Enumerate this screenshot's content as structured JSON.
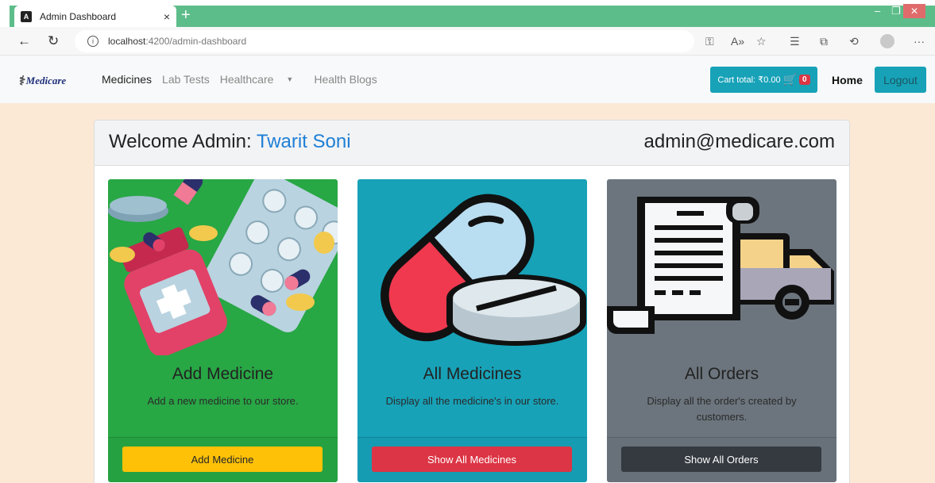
{
  "browser": {
    "tab_title": "Admin Dashboard",
    "tab_close": "×",
    "new_tab": "+",
    "url_host": "localhost",
    "url_path": ":4200/admin-dashboard",
    "more": "···"
  },
  "navbar": {
    "brand": "Medicare",
    "links": [
      "Medicines",
      "Lab Tests",
      "Healthcare",
      "Health Blogs"
    ],
    "cart_label": "Cart total: ₹0.00",
    "cart_count": "0",
    "home": "Home",
    "logout": "Logout"
  },
  "panel": {
    "welcome_prefix": "Welcome Admin:",
    "admin_name": "Twarit Soni",
    "admin_email": "admin@medicare.com"
  },
  "cards": [
    {
      "title": "Add Medicine",
      "text": "Add a new medicine to our store.",
      "button": "Add Medicine",
      "bg": "#28a745",
      "button_bg": "#ffc107",
      "button_fg": "#212529"
    },
    {
      "title": "All Medicines",
      "text": "Display all the medicine's in our store.",
      "button": "Show All Medicines",
      "bg": "#17a2b8",
      "button_bg": "#dc3545",
      "button_fg": "#ffffff"
    },
    {
      "title": "All Orders",
      "text": "Display all the order's created by customers.",
      "button": "Show All Orders",
      "bg": "#6c757d",
      "button_bg": "#343a40",
      "button_fg": "#ffffff"
    }
  ],
  "colors": {
    "page_bg": "#fbe9d6",
    "accent": "#17a2b8",
    "link_blue": "#1e7fd6"
  }
}
